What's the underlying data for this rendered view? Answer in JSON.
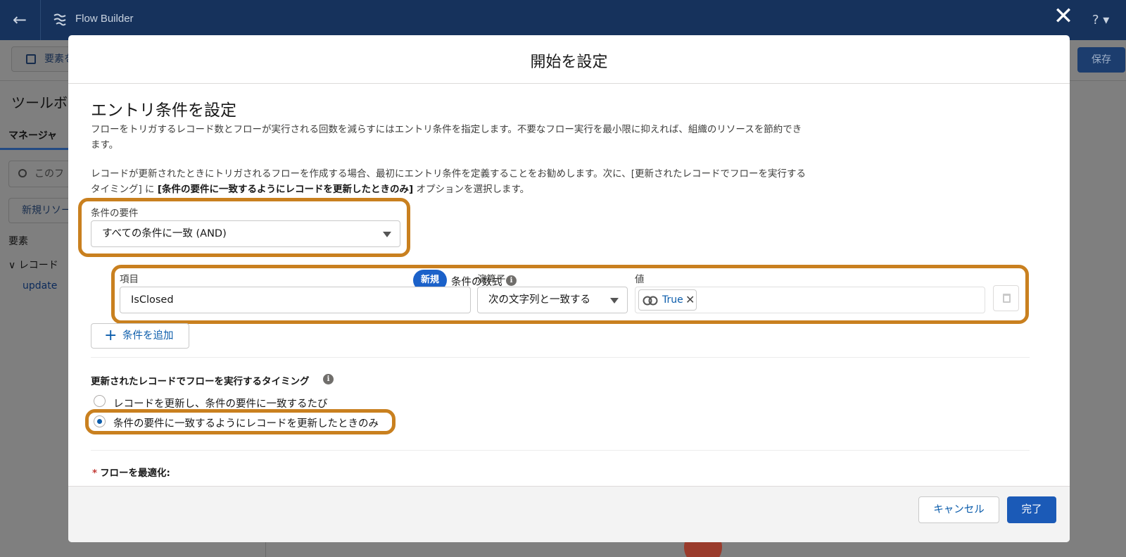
{
  "app": {
    "title": "Flow Builder",
    "toolbar_button": "要素を",
    "save": "保存",
    "help": "? ▾"
  },
  "sidebar": {
    "title": "ツールボ",
    "tab": "マネージャ",
    "search_placeholder": "このフ",
    "new_resource": "新規リソー",
    "elements_label": "要素",
    "record_group": "レコード",
    "update_item": "update"
  },
  "modal": {
    "title": "開始を設定",
    "section_title": "エントリ条件を設定",
    "desc1": "フローをトリガするレコード数とフローが実行される回数を減らすにはエントリ条件を指定します。不要なフロー実行を最小限に抑えれば、組織のリソースを節約できます。",
    "desc2_pre": "レコードが更新されたときにトリガされるフローを作成する場合、最初にエントリ条件を定義することをお勧めします。次に、[更新されたレコードでフローを実行するタイミング] に ",
    "desc2_bold": "[条件の要件に一致するようにレコードを更新したときのみ]",
    "desc2_post": " オプションを選択します。",
    "condition_requirement": {
      "label": "条件の要件",
      "value": "すべての条件に一致 (AND)"
    },
    "new_badge": "新規",
    "formula_label": "条件の数式",
    "condition_row": {
      "field_label": "項目",
      "field_value": "IsClosed",
      "operator_label": "演算子",
      "operator_value": "次の文字列と一致する",
      "value_label": "値",
      "value_pill": "True"
    },
    "add_condition": "条件を追加",
    "timing_label": "更新されたレコードでフローを実行するタイミング",
    "radio_options": [
      {
        "label": "レコードを更新し、条件の要件に一致するたび",
        "selected": false
      },
      {
        "label": "条件の要件に一致するようにレコードを更新したときのみ",
        "selected": true
      }
    ],
    "optimize_required": "*",
    "optimize_label": "フローを最適化:",
    "cancel": "キャンセル",
    "done": "完了"
  },
  "colors": {
    "header_navy": "#16325c",
    "highlight_orange": "#c9801f",
    "brand_blue": "#1b5ab7",
    "link_blue": "#0b5cab"
  }
}
